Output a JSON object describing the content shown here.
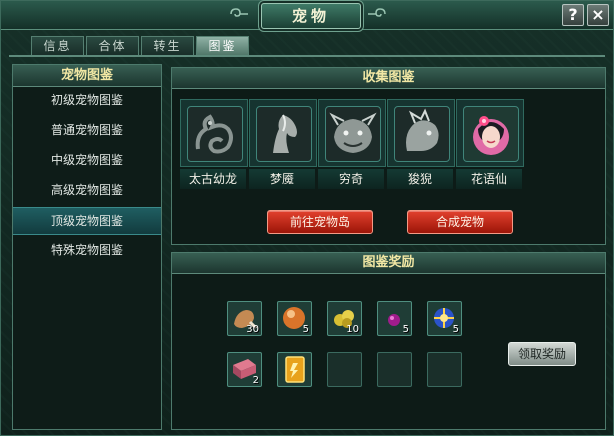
{
  "window": {
    "title": "宠物",
    "help_button": "?",
    "close_button": "×"
  },
  "tabs": [
    "信息",
    "合体",
    "转生",
    "图鉴"
  ],
  "active_tab": "图鉴",
  "catalog": {
    "title": "宠物图鉴",
    "items": [
      "初级宠物图鉴",
      "普通宠物图鉴",
      "中级宠物图鉴",
      "高级宠物图鉴",
      "顶级宠物图鉴",
      "特殊宠物图鉴"
    ],
    "selected": "顶级宠物图鉴"
  },
  "collection": {
    "title": "收集图鉴",
    "pets": [
      {
        "name": "太古幼龙",
        "icon": "dragon-icon"
      },
      {
        "name": "梦魇",
        "icon": "nightmare-horse-icon"
      },
      {
        "name": "穷奇",
        "icon": "qiongqi-beast-icon"
      },
      {
        "name": "狻猊",
        "icon": "suanni-lion-icon"
      },
      {
        "name": "花语仙",
        "icon": "flower-fairy-icon"
      }
    ],
    "goto_button": "前往宠物岛",
    "combine_button": "合成宠物"
  },
  "rewards": {
    "title": "图鉴奖励",
    "items": [
      {
        "icon": "meat-icon",
        "count": "30"
      },
      {
        "icon": "orange-orb-icon",
        "count": "5"
      },
      {
        "icon": "gold-nugget-icon",
        "count": "10"
      },
      {
        "icon": "purple-gem-icon",
        "count": "5"
      },
      {
        "icon": "blue-crystal-icon",
        "count": "5"
      },
      {
        "icon": "pink-book-icon",
        "count": "2"
      },
      {
        "icon": "gold-card-icon",
        "count": ""
      },
      {
        "icon": "empty-slot",
        "count": ""
      },
      {
        "icon": "empty-slot",
        "count": ""
      },
      {
        "icon": "empty-slot",
        "count": ""
      }
    ],
    "claim_button": "领取奖励"
  },
  "colors": {
    "accent": "#f1e7a4",
    "selected_row": "#1f5e61",
    "red_button": "#c9301f"
  }
}
